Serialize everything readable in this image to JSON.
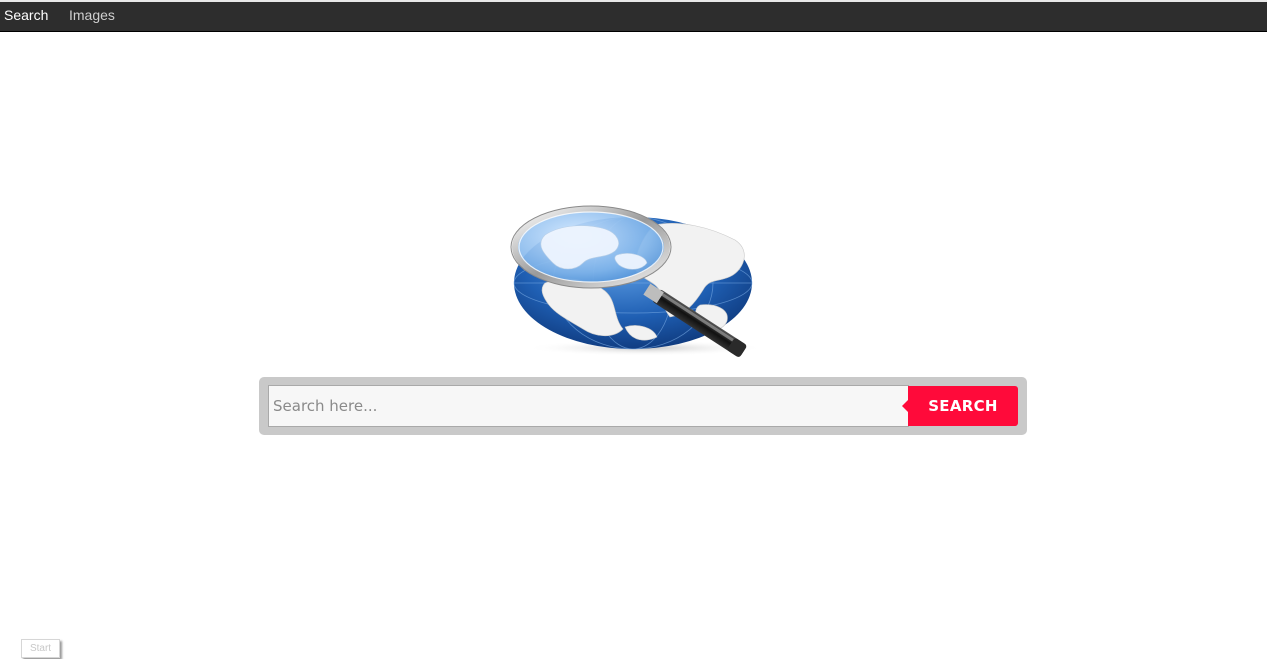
{
  "nav": {
    "items": [
      {
        "label": "Search",
        "active": true
      },
      {
        "label": "Images",
        "active": false
      }
    ]
  },
  "logo": {
    "icon": "globe-magnifier-icon"
  },
  "search": {
    "placeholder": "Search here...",
    "value": "",
    "button_label": "SEARCH"
  },
  "start_button": {
    "label": "Start"
  },
  "colors": {
    "topbar": "#2d2d2d",
    "frame": "#c9c9c9",
    "button": "#ff0a3a"
  }
}
